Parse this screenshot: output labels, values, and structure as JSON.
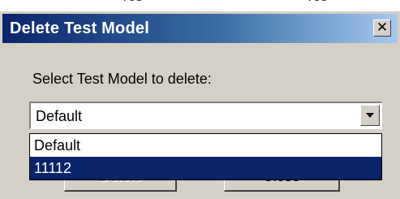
{
  "dialog": {
    "title": "Delete Test Model",
    "close_glyph": "✕",
    "prompt_label": "Select Test Model to delete:"
  },
  "combo": {
    "selected": "Default",
    "arrow_icon": "chevron-down-icon"
  },
  "dropdown": {
    "options": [
      "Default",
      "11112"
    ],
    "highlighted_index": 1
  },
  "buttons": {
    "delete_label": "Delete",
    "close_label": "Close"
  },
  "colors": {
    "title_bar_start": "#0a246a",
    "title_bar_end": "#a6caf0",
    "selection": "#0a246a",
    "dialog_face": "#d4d0c8"
  }
}
